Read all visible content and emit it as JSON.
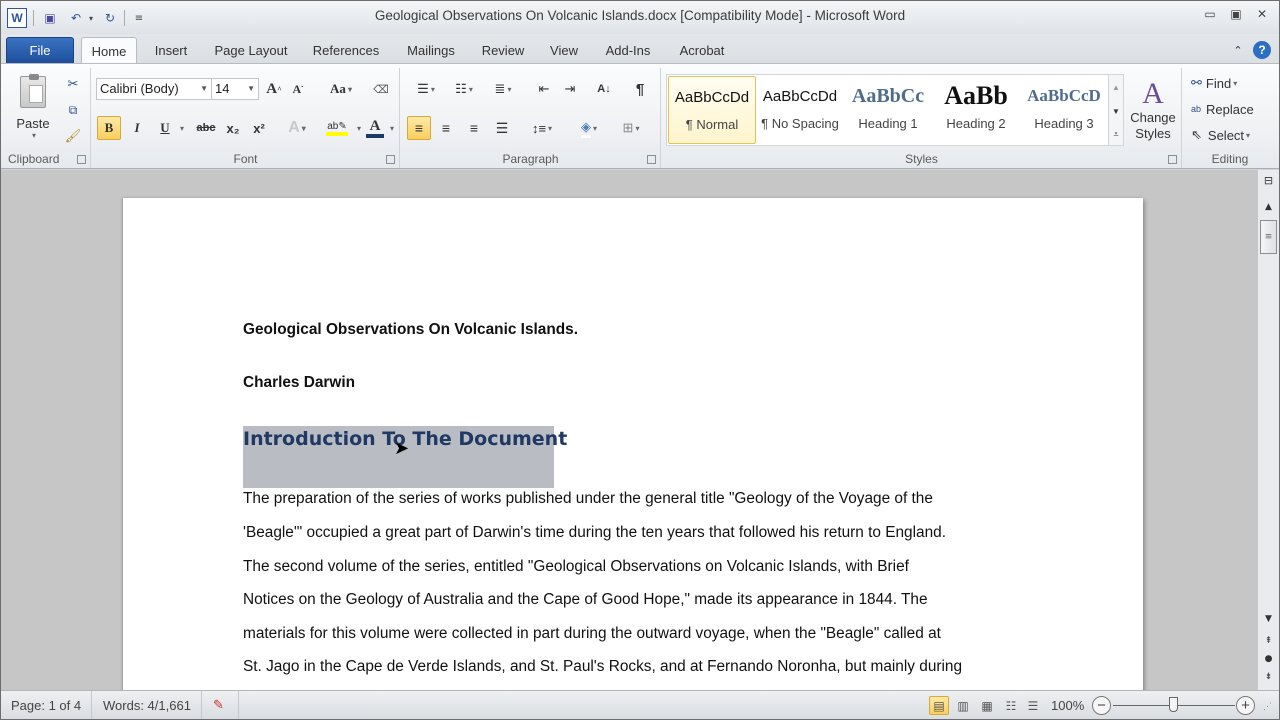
{
  "window": {
    "title": "Geological Observations On Volcanic Islands.docx [Compatibility Mode]  -  Microsoft Word",
    "app_icon": "W",
    "controls": {
      "minimize": "minimize-icon",
      "maximize": "maximize-icon",
      "close": "close-icon"
    }
  },
  "quick_access": [
    {
      "name": "save-icon",
      "glyph": "💾"
    },
    {
      "name": "undo-icon",
      "glyph": "↶"
    },
    {
      "name": "redo-icon",
      "glyph": "↻"
    },
    {
      "name": "customize-icon",
      "glyph": "▾"
    }
  ],
  "tabs": [
    {
      "label": "File"
    },
    {
      "label": "Home",
      "active": true
    },
    {
      "label": "Insert"
    },
    {
      "label": "Page Layout"
    },
    {
      "label": "References"
    },
    {
      "label": "Mailings"
    },
    {
      "label": "Review"
    },
    {
      "label": "View"
    },
    {
      "label": "Add-Ins"
    },
    {
      "label": "Acrobat"
    }
  ],
  "ribbon": {
    "clipboard": {
      "label": "Clipboard",
      "paste": "Paste"
    },
    "font": {
      "label": "Font",
      "family": "Calibri (Body)",
      "size": "14",
      "bold": "B",
      "italic": "I",
      "underline": "U",
      "strike": "abc",
      "subscript": "x₂",
      "superscript": "x²",
      "grow": "A",
      "shrink": "A",
      "case": "Aa"
    },
    "paragraph": {
      "label": "Paragraph",
      "pilcrow": "¶"
    },
    "styles": {
      "label": "Styles",
      "items": [
        {
          "preview": "AaBbCcDd",
          "name": "¶ Normal",
          "selected": true
        },
        {
          "preview": "AaBbCcDd",
          "name": "¶ No Spacing"
        },
        {
          "preview": "AaBbCc",
          "name": "Heading 1"
        },
        {
          "preview": "AaBb",
          "name": "Heading 2"
        },
        {
          "preview": "AaBbCcD",
          "name": "Heading 3"
        }
      ],
      "change_styles": "Change Styles"
    },
    "editing": {
      "label": "Editing",
      "find": "Find",
      "replace": "Replace",
      "select": "Select"
    }
  },
  "document": {
    "title_line": "Geological Observations On Volcanic Islands.",
    "author": "Charles Darwin",
    "heading": "Introduction To The Document",
    "lines": [
      "The preparation of the series of works published  under  the general title \"Geology of the Voyage of the",
      "'Beagle'\" occupied a great part of Darwin's time during  the ten years that followed his return to England.",
      "The second volume of the series, entitled \"Geological Observations on Volcanic Islands, with Brief",
      "Notices on the Geology of Australia and the Cape of Good Hope,\" made its appearance in 1844. The",
      "materials for this volume were collected in part during  the outward voyage, when the \"Beagle\" called at",
      "St. Jago in the Cape de Verde Islands, and St. Paul's Rocks, and at Fernando  Noronha, but mainly during"
    ]
  },
  "status": {
    "page": "Page: 1 of 4",
    "words": "Words: 4/1,661",
    "zoom": "100%",
    "zoom_level_percent": 100
  }
}
